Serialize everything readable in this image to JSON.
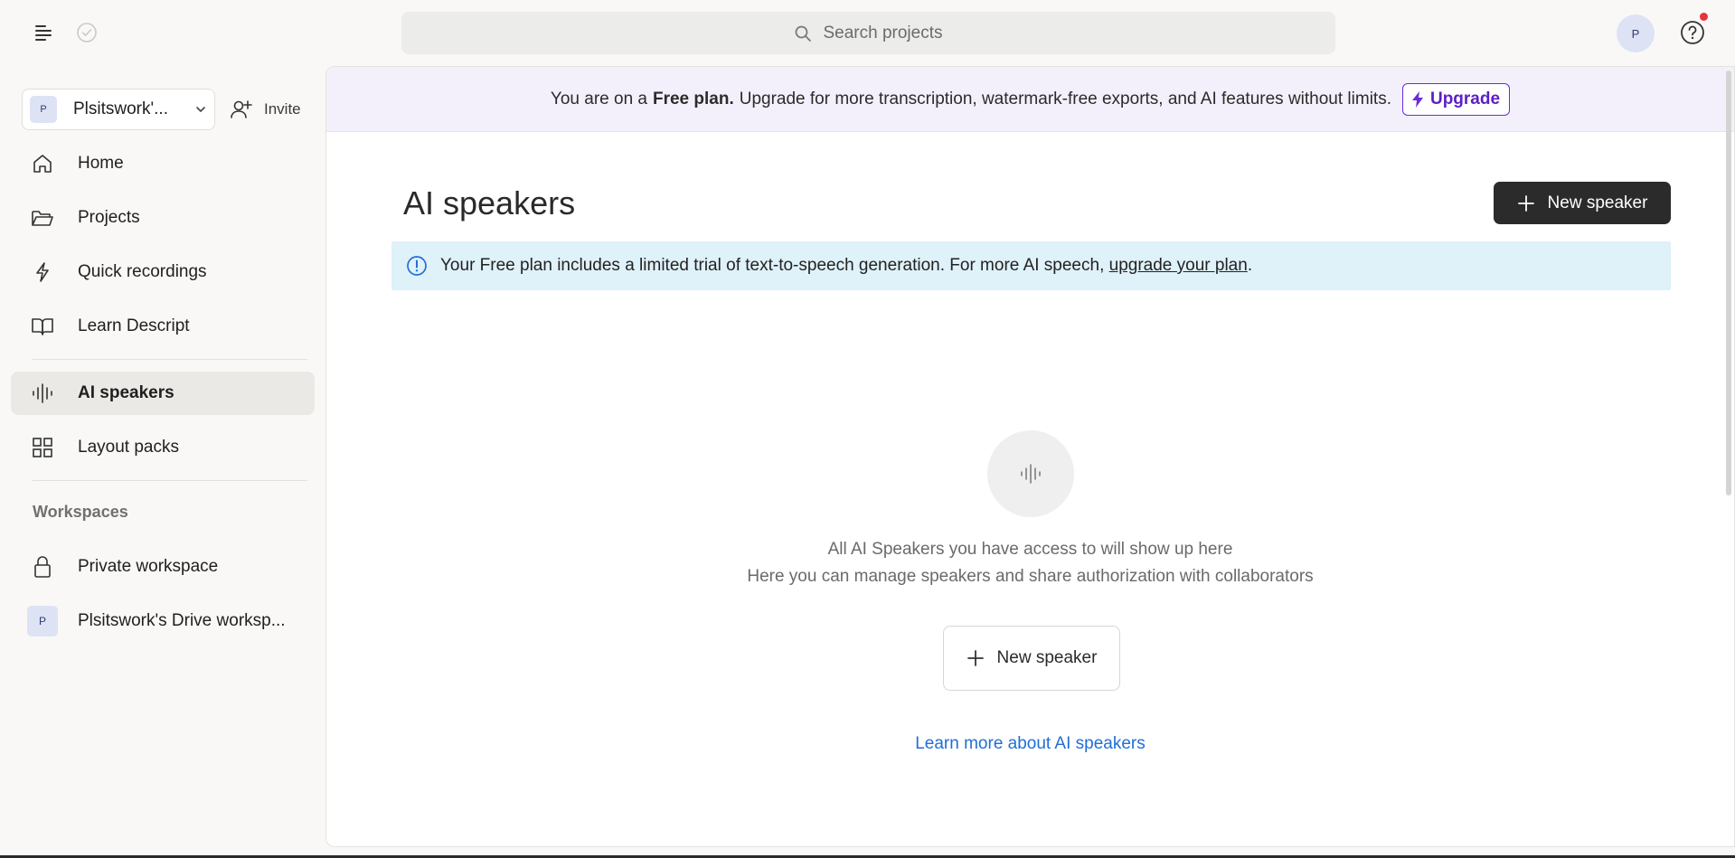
{
  "topbar": {
    "search_placeholder": "Search projects",
    "avatar_initial": "P"
  },
  "sidebar": {
    "workspace_initial": "P",
    "workspace_name": "Plsitswork'...",
    "invite_label": "Invite",
    "nav": [
      {
        "label": "Home",
        "icon": "home-icon"
      },
      {
        "label": "Projects",
        "icon": "folder-icon"
      },
      {
        "label": "Quick recordings",
        "icon": "lightning-icon"
      },
      {
        "label": "Learn Descript",
        "icon": "book-icon"
      },
      {
        "label": "AI speakers",
        "icon": "waveform-icon",
        "active": true
      },
      {
        "label": "Layout packs",
        "icon": "grid-icon"
      }
    ],
    "workspaces_heading": "Workspaces",
    "workspaces": [
      {
        "label": "Private workspace",
        "icon": "lock-icon"
      },
      {
        "label": "Plsitswork's Drive worksp...",
        "initial": "P"
      }
    ]
  },
  "banner": {
    "prefix": "You are on a",
    "plan": "Free plan.",
    "suffix": "Upgrade for more transcription, watermark-free exports, and AI features without limits.",
    "upgrade_label": "Upgrade"
  },
  "main": {
    "title": "AI speakers",
    "new_speaker_label": "New speaker",
    "info_text": "Your Free plan includes a limited trial of text-to-speech generation. For more AI speech,",
    "info_link": "upgrade your plan",
    "info_end": ".",
    "empty_line1": "All AI Speakers you have access to will show up here",
    "empty_line2": "Here you can manage speakers and share authorization with collaborators",
    "empty_button_label": "New speaker",
    "learn_more": "Learn more about AI speakers"
  },
  "colors": {
    "accent_purple": "#6c2bd9",
    "link_blue": "#1f6fd6",
    "info_bg": "#dff1f9",
    "notification": "#e5343b"
  }
}
